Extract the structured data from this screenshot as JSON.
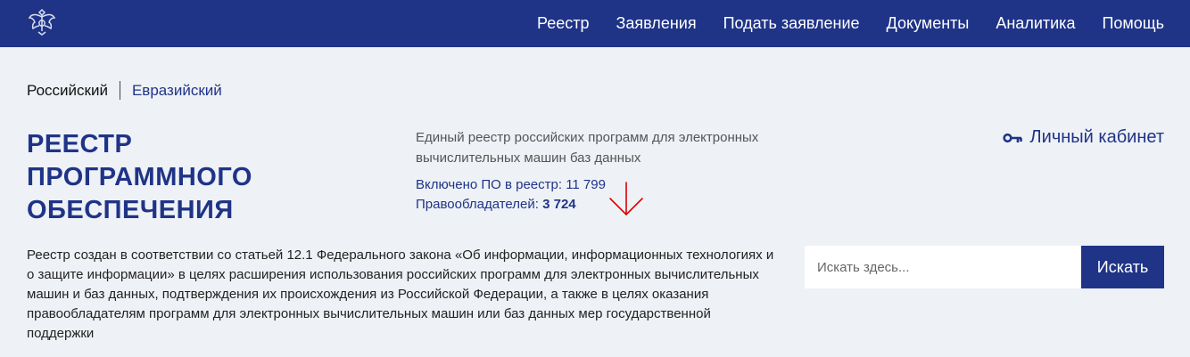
{
  "nav": {
    "items": [
      "Реестр",
      "Заявления",
      "Подать заявление",
      "Документы",
      "Аналитика",
      "Помощь"
    ]
  },
  "registry_switch": {
    "active": "Российский",
    "other": "Евразийский"
  },
  "hero": {
    "title": "Реестр программного обеспечения",
    "description": "Единый реестр российских программ для электронных вычислительных машин баз данных",
    "stat_software_label": "Включено ПО в реестр: ",
    "stat_software_value": "11 799",
    "stat_owners_label": "Правообладателей: ",
    "stat_owners_value": "3 724"
  },
  "account": {
    "label": "Личный кабинет"
  },
  "about": {
    "text": "Реестр создан в соответствии со статьей 12.1 Федерального закона «Об информации, информационных технологиях и о защите информации» в целях расширения использования российских программ для электронных вычислительных машин и баз данных, подтверждения их происхождения из Российской Федерации, а также в целях оказания правообладателям программ для электронных вычислительных машин или баз данных мер государственной поддержки"
  },
  "search": {
    "placeholder": "Искать здесь...",
    "button_label": "Искать"
  },
  "colors": {
    "header_bg": "#1f3487",
    "page_bg": "#eef1f6",
    "accent": "#1f3487",
    "annotation_arrow": "#e00000"
  },
  "icons": {
    "emblem": "coat-of-arms-icon",
    "account": "key-icon",
    "annotation": "arrow-down-icon"
  }
}
